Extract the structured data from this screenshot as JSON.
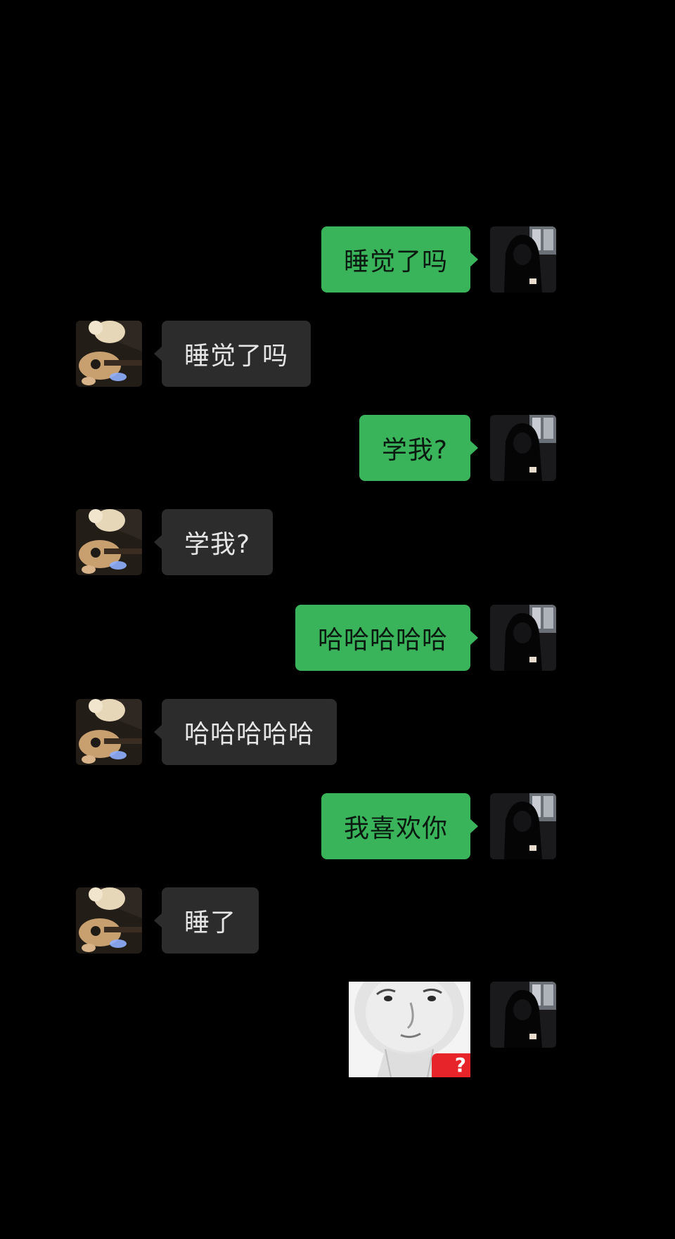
{
  "conversation": {
    "messages": [
      {
        "side": "out",
        "text": "睡觉了吗"
      },
      {
        "side": "in",
        "text": "睡觉了吗"
      },
      {
        "side": "out",
        "text": "学我?"
      },
      {
        "side": "in",
        "text": "学我?"
      },
      {
        "side": "out",
        "text": "哈哈哈哈哈"
      },
      {
        "side": "in",
        "text": "哈哈哈哈哈"
      },
      {
        "side": "out",
        "text": "我喜欢你"
      },
      {
        "side": "in",
        "text": "睡了"
      },
      {
        "side": "out",
        "type": "sticker",
        "sticker_icon": "face-sticker",
        "badge_text": "?"
      }
    ]
  },
  "colors": {
    "background": "#000000",
    "outgoing_bubble": "#3ab45a",
    "incoming_bubble": "#2c2c2c"
  },
  "avatars": {
    "self": "dark-hooded-figure-avatar",
    "contact": "guitar-player-avatar"
  }
}
